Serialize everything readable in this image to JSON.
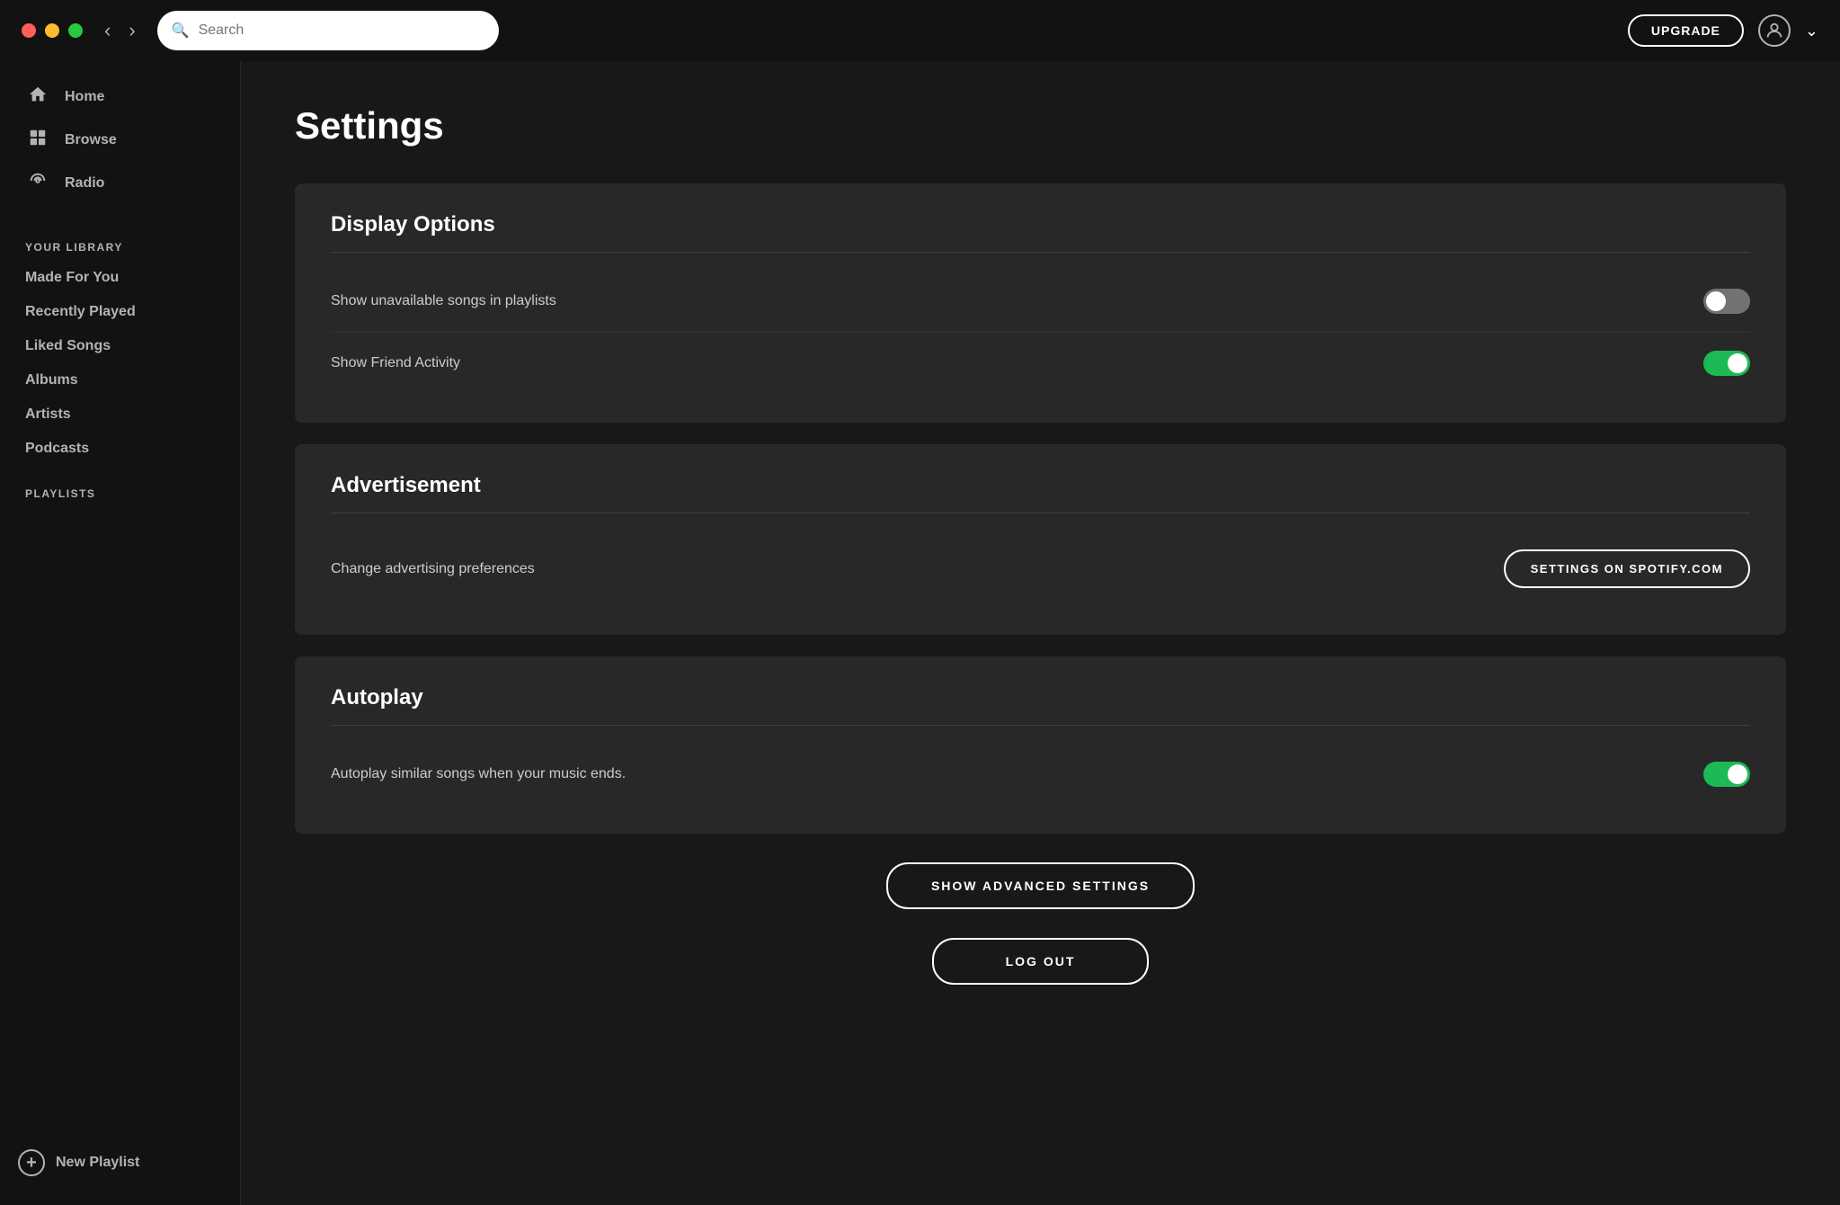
{
  "titlebar": {
    "search_placeholder": "Search",
    "upgrade_label": "UPGRADE",
    "dropdown_label": "▾"
  },
  "sidebar": {
    "nav_items": [
      {
        "label": "Home",
        "icon": "home"
      },
      {
        "label": "Browse",
        "icon": "browse"
      },
      {
        "label": "Radio",
        "icon": "radio"
      }
    ],
    "your_library_label": "YOUR LIBRARY",
    "library_items": [
      "Made For You",
      "Recently Played",
      "Liked Songs",
      "Albums",
      "Artists",
      "Podcasts"
    ],
    "playlists_label": "PLAYLISTS",
    "new_playlist_label": "New Playlist"
  },
  "settings": {
    "page_title": "Settings",
    "sections": [
      {
        "id": "display-options",
        "title": "Display Options",
        "settings": [
          {
            "id": "show-unavailable",
            "label": "Show unavailable songs in playlists",
            "type": "toggle",
            "value": false
          },
          {
            "id": "show-friend-activity",
            "label": "Show Friend Activity",
            "type": "toggle",
            "value": true
          }
        ]
      },
      {
        "id": "advertisement",
        "title": "Advertisement",
        "settings": [
          {
            "id": "advertising-prefs",
            "label": "Change advertising preferences",
            "type": "button",
            "button_label": "SETTINGS ON SPOTIFY.COM"
          }
        ]
      },
      {
        "id": "autoplay",
        "title": "Autoplay",
        "settings": [
          {
            "id": "autoplay-similar",
            "label": "Autoplay similar songs when your music ends.",
            "type": "toggle",
            "value": true
          }
        ]
      }
    ],
    "show_advanced_label": "SHOW ADVANCED SETTINGS",
    "logout_label": "LOG OUT"
  }
}
